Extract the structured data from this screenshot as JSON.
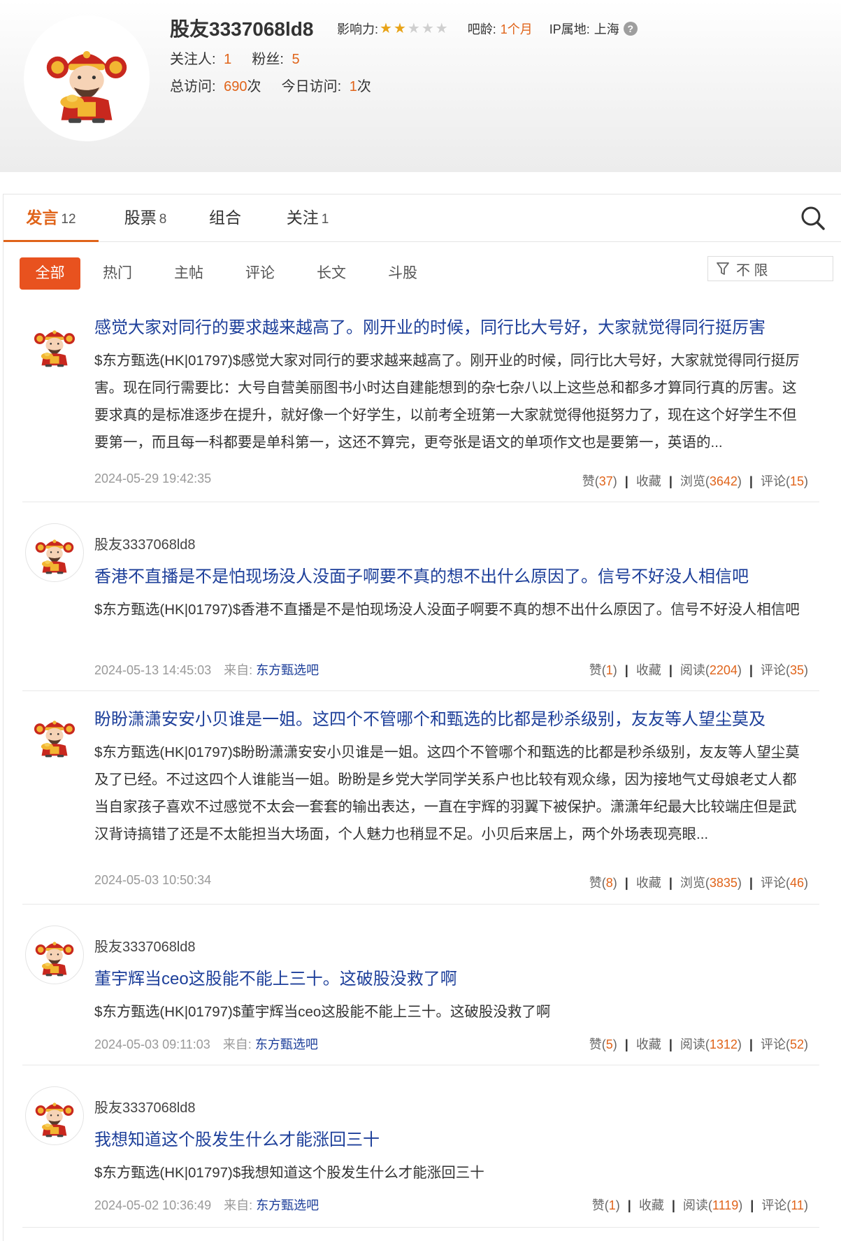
{
  "profile": {
    "username": "股友3337068ld8",
    "influence_label": "影响力:",
    "influence_stars": 2,
    "influence_max": 5,
    "ba_age_label": "吧龄:",
    "ba_age_value": "1个月",
    "ip_label": "IP属地:",
    "ip_value": "上海",
    "following_label": "关注人:",
    "following_value": "1",
    "fans_label": "粉丝:",
    "fans_value": "5",
    "total_visits_label": "总访问:",
    "total_visits_value": "690",
    "today_visits_label": "今日访问:",
    "today_visits_value": "1",
    "visits_unit": "次"
  },
  "tabs": [
    {
      "label": "发言",
      "count": "12",
      "active": true
    },
    {
      "label": "股票",
      "count": "8",
      "active": false
    },
    {
      "label": "组合",
      "count": "",
      "active": false
    },
    {
      "label": "关注",
      "count": "1",
      "active": false
    }
  ],
  "filters": [
    "全部",
    "热门",
    "主帖",
    "评论",
    "长文",
    "斗股"
  ],
  "scope": "不 限",
  "stat_labels": {
    "like": "赞",
    "favorite": "收藏",
    "browse": "浏览",
    "read": "阅读",
    "comment": "评论",
    "from": "来自:"
  },
  "posts": [
    {
      "author": "",
      "title": "感觉大家对同行的要求越来越高了。刚开业的时候，同行比大号好，大家就觉得同行挺厉害",
      "body": "$东方甄选(HK|01797)$感觉大家对同行的要求越来越高了。刚开业的时候，同行比大号好，大家就觉得同行挺厉害。现在同行需要比：大号自营美丽图书小时达自建能想到的杂七杂八以上这些总和都多才算同行真的厉害。这要求真的是标准逐步在提升，就好像一个好学生，以前考全班第一大家就觉得他挺努力了，现在这个好学生不但要第一，而且每一科都要是单科第一，这还不算完，更夸张是语文的单项作文也是要第一，英语的...",
      "time": "2024-05-29 19:42:35",
      "source": "",
      "likes": "37",
      "views_label": "浏览",
      "views": "3642",
      "comments": "15"
    },
    {
      "author": "股友3337068ld8",
      "title": "香港不直播是不是怕现场没人没面子啊要不真的想不出什么原因了。信号不好没人相信吧",
      "body": "$东方甄选(HK|01797)$香港不直播是不是怕现场没人没面子啊要不真的想不出什么原因了。信号不好没人相信吧",
      "time": "2024-05-13 14:45:03",
      "source": "东方甄选吧",
      "likes": "1",
      "views_label": "阅读",
      "views": "2204",
      "comments": "35"
    },
    {
      "author": "",
      "title": "盼盼潇潇安安小贝谁是一姐。这四个不管哪个和甄选的比都是秒杀级别，友友等人望尘莫及",
      "body": "$东方甄选(HK|01797)$盼盼潇潇安安小贝谁是一姐。这四个不管哪个和甄选的比都是秒杀级别，友友等人望尘莫及了已经。不过这四个人谁能当一姐。盼盼是乡党大学同学关系户也比较有观众缘，因为接地气丈母娘老丈人都当自家孩子喜欢不过感觉不太会一套套的输出表达，一直在宇辉的羽翼下被保护。潇潇年纪最大比较端庄但是武汉背诗搞错了还是不太能担当大场面，个人魅力也稍显不足。小贝后来居上，两个外场表现亮眼...",
      "time": "2024-05-03 10:50:34",
      "source": "",
      "likes": "8",
      "views_label": "浏览",
      "views": "3835",
      "comments": "46"
    },
    {
      "author": "股友3337068ld8",
      "title": "董宇辉当ceo这股能不能上三十。这破股没救了啊",
      "body": "$东方甄选(HK|01797)$董宇辉当ceo这股能不能上三十。这破股没救了啊",
      "time": "2024-05-03 09:11:03",
      "source": "东方甄选吧",
      "likes": "5",
      "views_label": "阅读",
      "views": "1312",
      "comments": "52"
    },
    {
      "author": "股友3337068ld8",
      "title": "我想知道这个股发生什么才能涨回三十",
      "body": "$东方甄选(HK|01797)$我想知道这个股发生什么才能涨回三十",
      "time": "2024-05-02 10:36:49",
      "source": "东方甄选吧",
      "likes": "1",
      "views_label": "阅读",
      "views": "1119",
      "comments": "11"
    }
  ]
}
